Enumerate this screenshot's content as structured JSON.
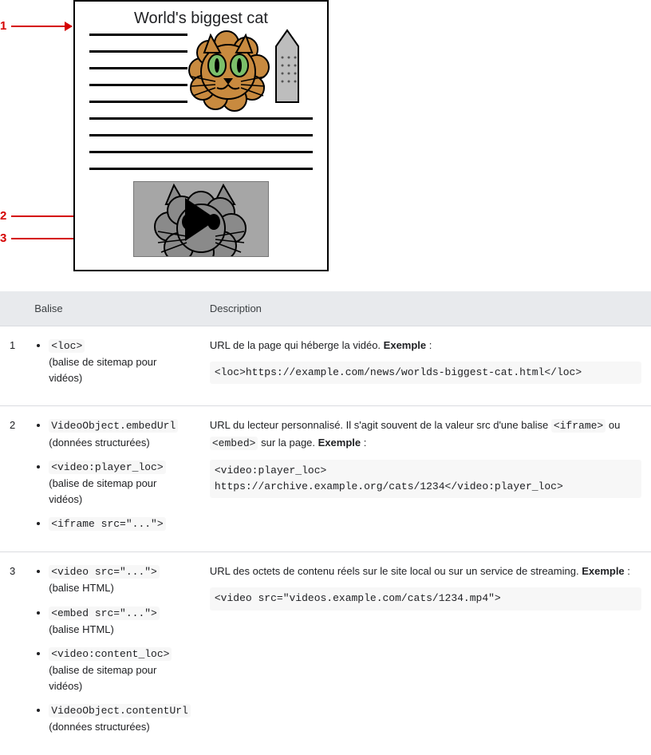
{
  "diagram": {
    "page_title": "World's biggest cat",
    "labels": [
      "1",
      "2",
      "3"
    ]
  },
  "table": {
    "headers": {
      "num": "",
      "tag": "Balise",
      "desc": "Description"
    },
    "rows": [
      {
        "num": "1",
        "tags": [
          {
            "code": "<loc>",
            "sublabel": "(balise de sitemap pour vidéos)"
          }
        ],
        "desc_pre": "URL de la page qui héberge la vidéo. ",
        "example_label": "Exemple",
        "desc_post": " :",
        "example_code": "<loc>https://example.com/news/worlds-biggest-cat.html</loc>"
      },
      {
        "num": "2",
        "tags": [
          {
            "code": "VideoObject.embedUrl",
            "sublabel": "(données structurées)"
          },
          {
            "code": "<video:player_loc>",
            "sublabel": "(balise de sitemap pour vidéos)"
          },
          {
            "code": "<iframe src=\"...\">",
            "sublabel": ""
          }
        ],
        "desc_pre": "URL du lecteur personnalisé. Il s'agit souvent de la valeur src d'une balise ",
        "inline_code_1": "<iframe>",
        "desc_mid": " ou ",
        "inline_code_2": "<embed>",
        "desc_mid2": " sur la page. ",
        "example_label": "Exemple",
        "desc_post": " :",
        "example_code": "<video:player_loc>\nhttps://archive.example.org/cats/1234</video:player_loc>"
      },
      {
        "num": "3",
        "tags": [
          {
            "code": "<video src=\"...\">",
            "sublabel": "(balise HTML)"
          },
          {
            "code": "<embed src=\"...\">",
            "sublabel": "(balise HTML)"
          },
          {
            "code": "<video:content_loc>",
            "sublabel": "(balise de sitemap pour vidéos)"
          },
          {
            "code": "VideoObject.contentUrl",
            "sublabel": "(données structurées)"
          }
        ],
        "desc_pre": "URL des octets de contenu réels sur le site local ou sur un service de streaming. ",
        "example_label": "Exemple",
        "desc_post": " :",
        "example_code": "<video src=\"videos.example.com/cats/1234.mp4\">"
      }
    ]
  }
}
